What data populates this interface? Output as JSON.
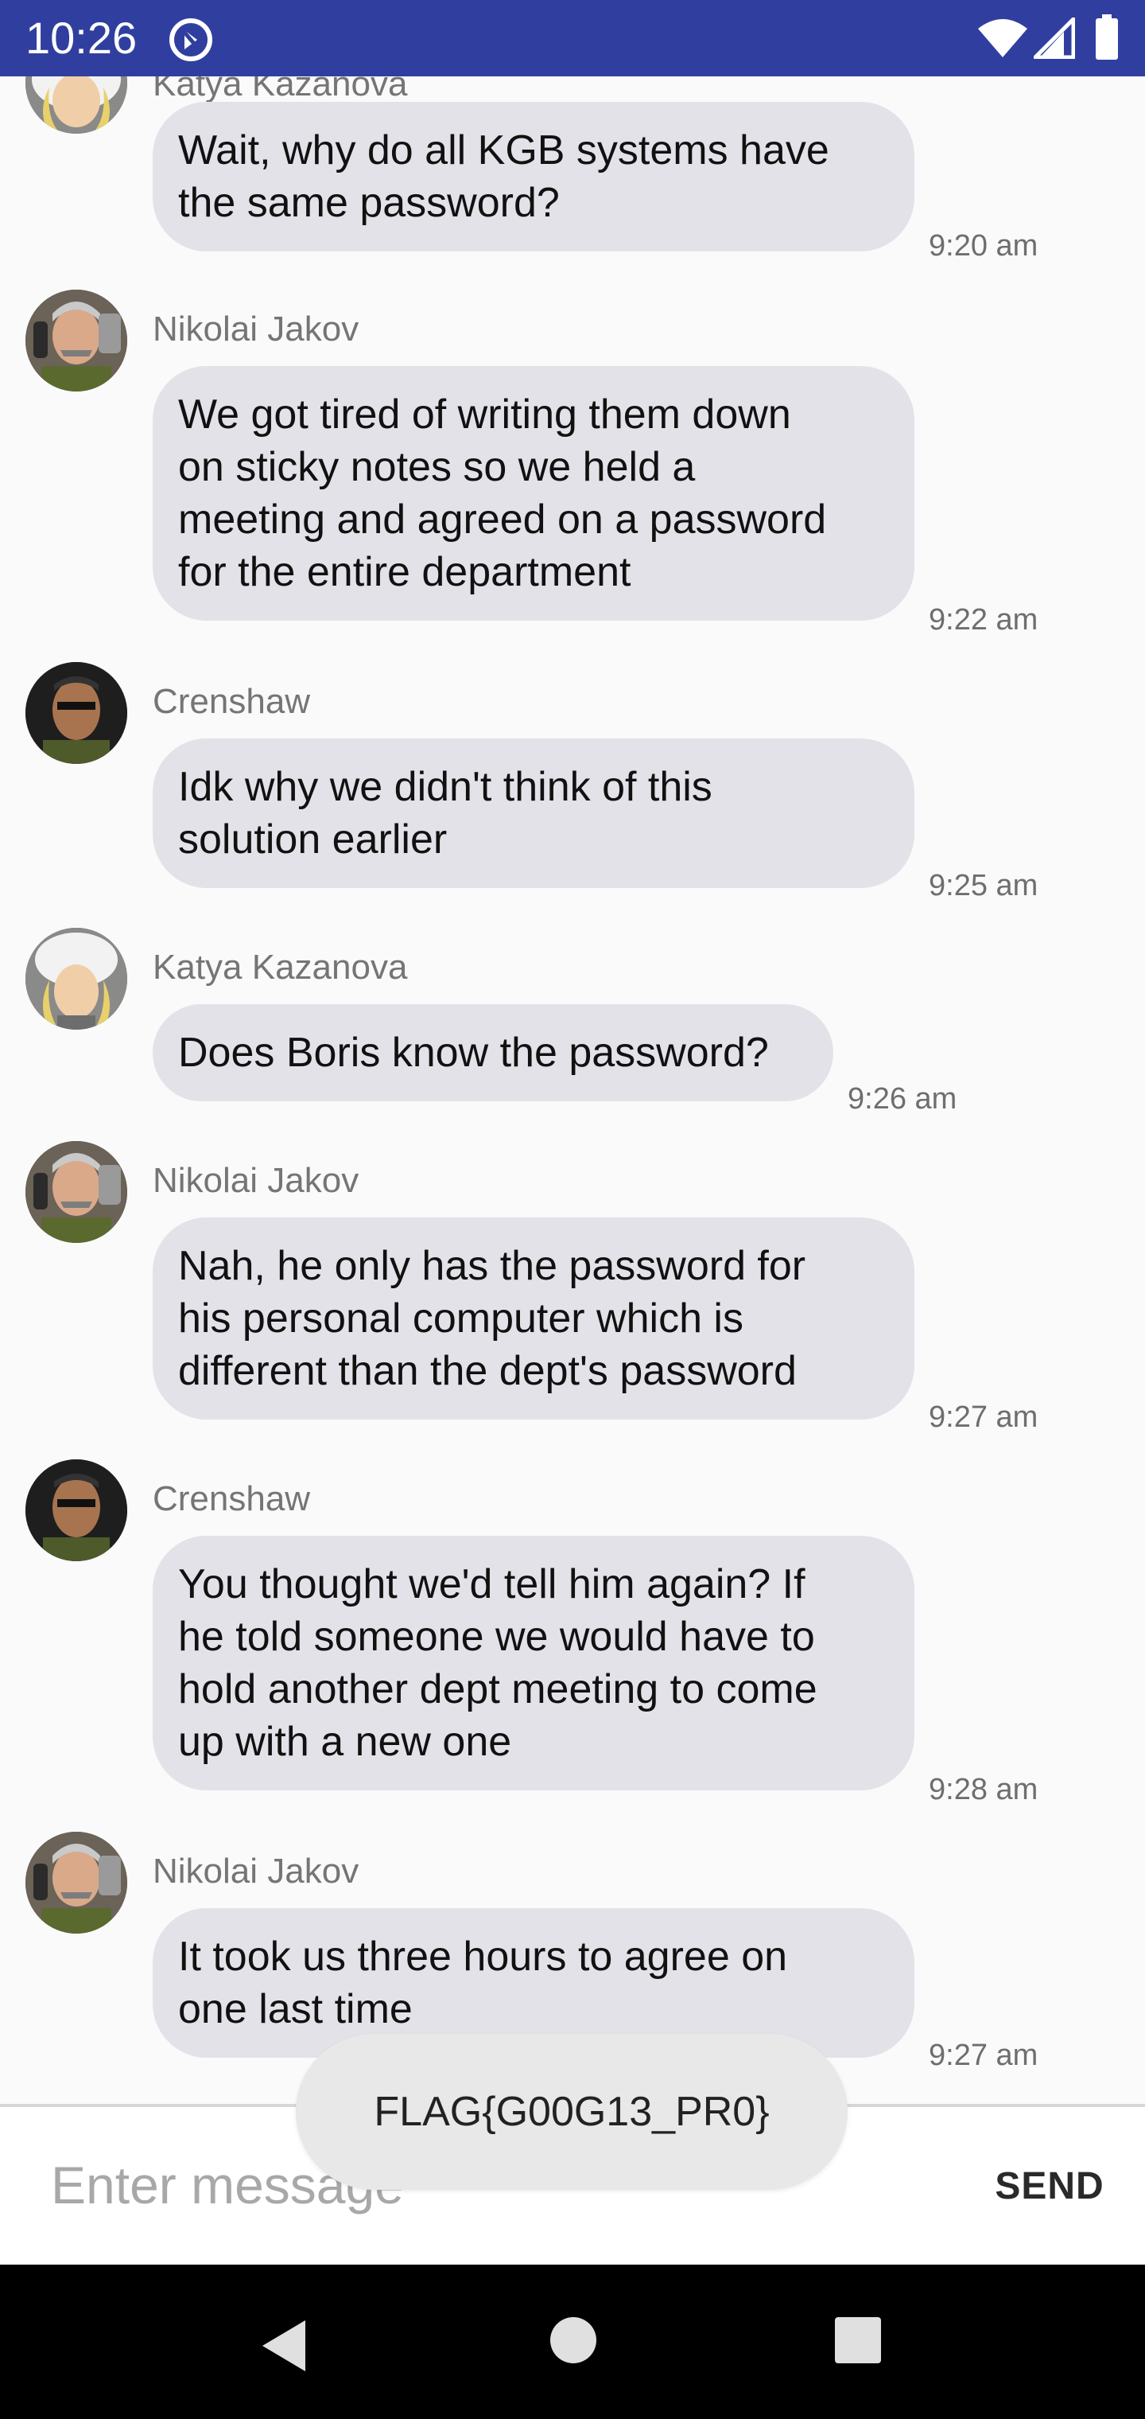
{
  "status_bar": {
    "time": "10:26",
    "background": "#303f9f"
  },
  "messages": [
    {
      "sender": "Katya Kazanova",
      "avatar": "katya-avatar",
      "text": "Wait, why do all KGB systems have\nthe same password?",
      "time": "9:20 am"
    },
    {
      "sender": "Nikolai Jakov",
      "avatar": "nikolai-avatar",
      "text": "We got tired of writing them down\non sticky notes so we held a\nmeeting and agreed on a password\nfor the entire department",
      "time": "9:22 am"
    },
    {
      "sender": "Crenshaw",
      "avatar": "crenshaw-avatar",
      "text": "Idk why we didn't think of this\nsolution earlier",
      "time": "9:25 am"
    },
    {
      "sender": "Katya Kazanova",
      "avatar": "katya-avatar",
      "text": "Does Boris know the password?",
      "time": "9:26 am"
    },
    {
      "sender": "Nikolai Jakov",
      "avatar": "nikolai-avatar",
      "text": "Nah, he only has the password for\nhis personal computer which is\ndifferent than the dept's password",
      "time": "9:27 am"
    },
    {
      "sender": "Crenshaw",
      "avatar": "crenshaw-avatar",
      "text": "You thought we'd tell him again? If\nhe told someone we would have to\nhold another dept meeting to come\nup with a new one",
      "time": "9:28 am"
    },
    {
      "sender": "Nikolai Jakov",
      "avatar": "nikolai-avatar",
      "text": "It took us three hours to agree on\none last time",
      "time": "9:27 am"
    }
  ],
  "toast": {
    "text": "FLAG{G00G13_PR0}"
  },
  "composer": {
    "placeholder": "Enter message",
    "send_label": "SEND"
  },
  "colors": {
    "bubble": "#e3e2e8",
    "background": "#fafafa",
    "sender_text": "#757575"
  }
}
